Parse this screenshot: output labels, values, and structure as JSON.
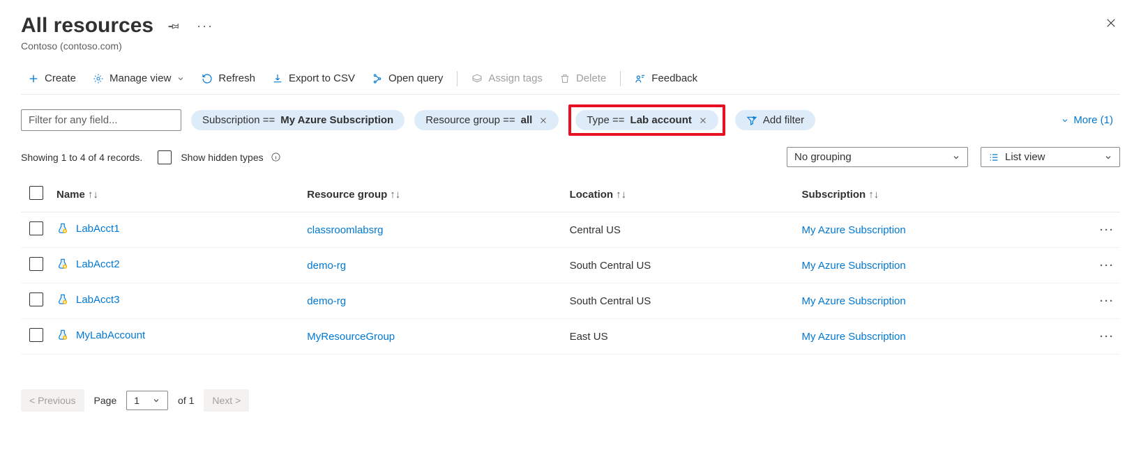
{
  "header": {
    "title": "All resources",
    "subtitle": "Contoso (contoso.com)"
  },
  "toolbar": {
    "create": "Create",
    "manage_view": "Manage view",
    "refresh": "Refresh",
    "export_csv": "Export to CSV",
    "open_query": "Open query",
    "assign_tags": "Assign tags",
    "delete": "Delete",
    "feedback": "Feedback"
  },
  "filters": {
    "placeholder": "Filter for any field...",
    "subscription": {
      "field": "Subscription == ",
      "value": "My Azure Subscription"
    },
    "resource_group": {
      "field": "Resource group == ",
      "value": "all"
    },
    "type": {
      "field": "Type == ",
      "value": "Lab account"
    },
    "add_filter": "Add filter",
    "more": "More (1)"
  },
  "status": {
    "records_text": "Showing 1 to 4 of 4 records.",
    "show_hidden": "Show hidden types",
    "grouping": "No grouping",
    "view_mode": "List view"
  },
  "columns": {
    "name": "Name",
    "resource_group": "Resource group",
    "location": "Location",
    "subscription": "Subscription"
  },
  "rows": [
    {
      "name": "LabAcct1",
      "rg": "classroomlabsrg",
      "location": "Central US",
      "subscription": "My Azure Subscription"
    },
    {
      "name": "LabAcct2",
      "rg": "demo-rg",
      "location": "South Central US",
      "subscription": "My Azure Subscription"
    },
    {
      "name": "LabAcct3",
      "rg": "demo-rg",
      "location": "South Central US",
      "subscription": "My Azure Subscription"
    },
    {
      "name": "MyLabAccount",
      "rg": "MyResourceGroup",
      "location": "East US",
      "subscription": "My Azure Subscription"
    }
  ],
  "pager": {
    "previous": "< Previous",
    "page_label": "Page",
    "current": "1",
    "of_total": "of 1",
    "next": "Next >"
  }
}
